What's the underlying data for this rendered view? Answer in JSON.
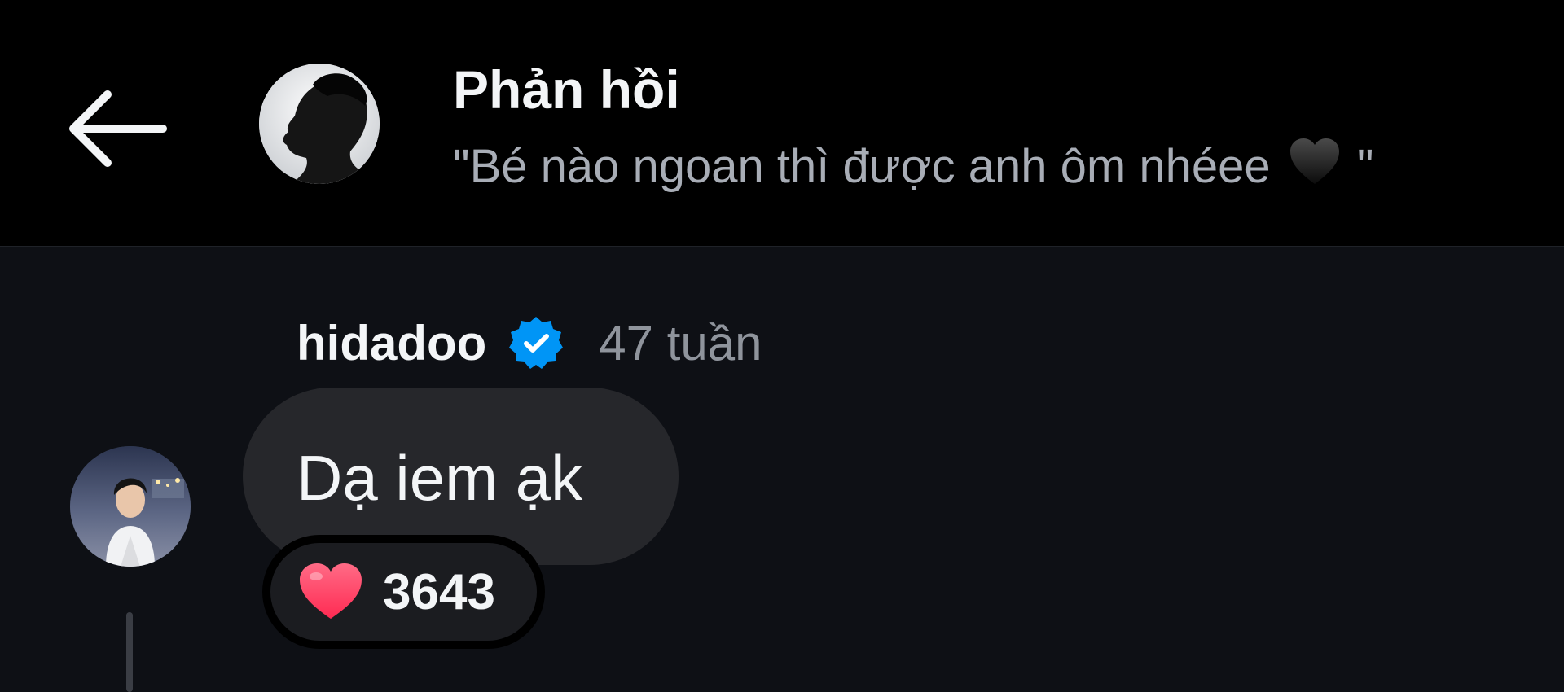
{
  "header": {
    "back_icon": "arrow-left-icon",
    "title": "Phản hồi",
    "subtitle_prefix": "\"Bé nào ngoan thì được anh ôm nhéee",
    "subtitle_suffix": "\"",
    "subtitle_emoji": "black-heart-icon"
  },
  "reply": {
    "username": "hidadoo",
    "verified_icon": "verified-badge-icon",
    "timestamp": "47 tuần",
    "message": "Dạ iem ạk",
    "like_icon": "heart-icon",
    "like_count": "3643"
  },
  "colors": {
    "header_bg": "#000000",
    "page_bg": "#0e1015",
    "bubble_bg": "#26272b",
    "verified_blue": "#0095f6",
    "heart_red": "#ff3b5c"
  }
}
